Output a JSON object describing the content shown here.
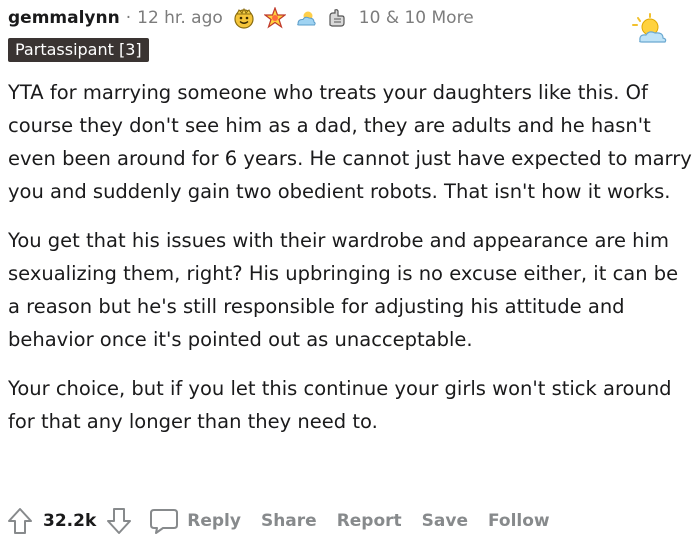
{
  "comment": {
    "author": "gemmalynn",
    "separator": "·",
    "timestamp": "12 hr. ago",
    "awards": [
      {
        "icon": "wholesome-award-icon"
      },
      {
        "icon": "starstruck-award-icon"
      },
      {
        "icon": "sun-cloud-award-icon"
      },
      {
        "icon": "hands-award-icon"
      }
    ],
    "more_awards_text": "10 & 10 More",
    "corner_badge_icon": "sun-cloud-badge-icon",
    "flair": "Partassipant [3]",
    "paragraphs": [
      "YTA for marrying someone who treats your daughters like this. Of course they don't see him as a dad, they are adults and he hasn't even been around for 6 years. He cannot just have expected to marry you and suddenly gain two obedient robots. That isn't how it works.",
      "You get that his issues with their wardrobe and appearance are him sexualizing them, right? His upbringing is no excuse either, it can be a reason but he's still responsible for adjusting his attitude and behavior once it's pointed out as unacceptable.",
      "Your choice, but if you let this continue your girls won't stick around for that any longer than they need to."
    ],
    "score": "32.2k",
    "actions": {
      "reply": "Reply",
      "share": "Share",
      "report": "Report",
      "save": "Save",
      "follow": "Follow"
    }
  },
  "colors": {
    "text": "#1a1a1b",
    "meta": "#7c7c7c",
    "flair_bg": "#3a3432",
    "action": "#878a8c"
  }
}
